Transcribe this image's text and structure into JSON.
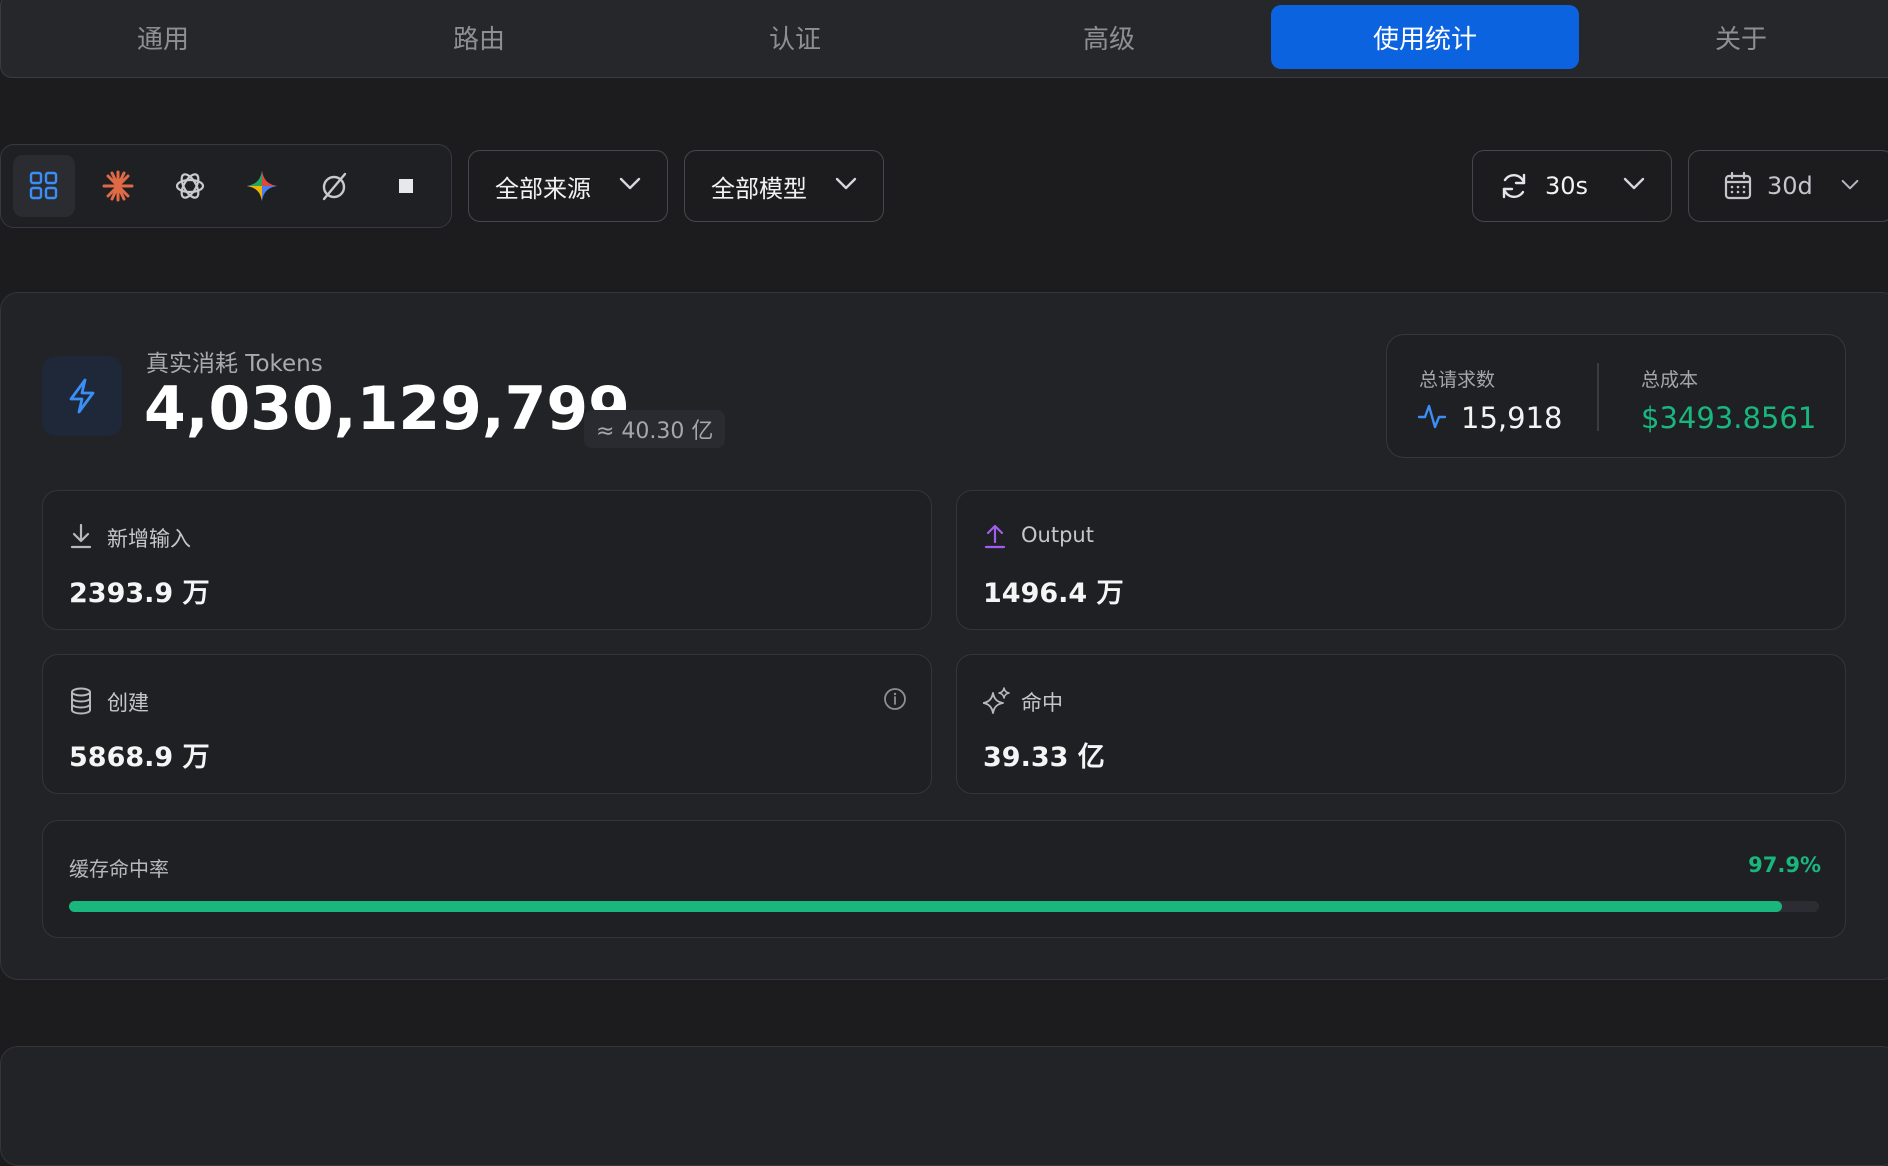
{
  "tabs": [
    {
      "label": "通用"
    },
    {
      "label": "路由"
    },
    {
      "label": "认证"
    },
    {
      "label": "高级"
    },
    {
      "label": "使用统计",
      "active": true
    },
    {
      "label": "关于"
    }
  ],
  "toolbar": {
    "providers": [
      "grid-icon",
      "claude-icon",
      "openai-icon",
      "gemini-icon",
      "slashed-circle-icon",
      "square-icon"
    ],
    "source_select": "全部来源",
    "model_select": "全部模型",
    "refresh_select": "30s",
    "range_select": "30d"
  },
  "hero": {
    "label": "真实消耗 Tokens",
    "value": "4,030,129,799",
    "approx": "≈ 40.30 亿"
  },
  "summary": {
    "requests_label": "总请求数",
    "requests_value": "15,918",
    "cost_label": "总成本",
    "cost_value": "$3493.8561"
  },
  "cards": {
    "input": {
      "label": "新增输入",
      "value": "2393.9 万"
    },
    "output": {
      "label": "Output",
      "value": "1496.4 万"
    },
    "create": {
      "label": "创建",
      "value": "5868.9 万"
    },
    "hit": {
      "label": "命中",
      "value": "39.33 亿"
    }
  },
  "cache_rate": {
    "label": "缓存命中率",
    "value": "97.9%",
    "fraction": 0.979
  },
  "colors": {
    "accent_blue": "#0b63e0",
    "success_green": "#19b67d",
    "output_purple": "#a35cf0"
  }
}
